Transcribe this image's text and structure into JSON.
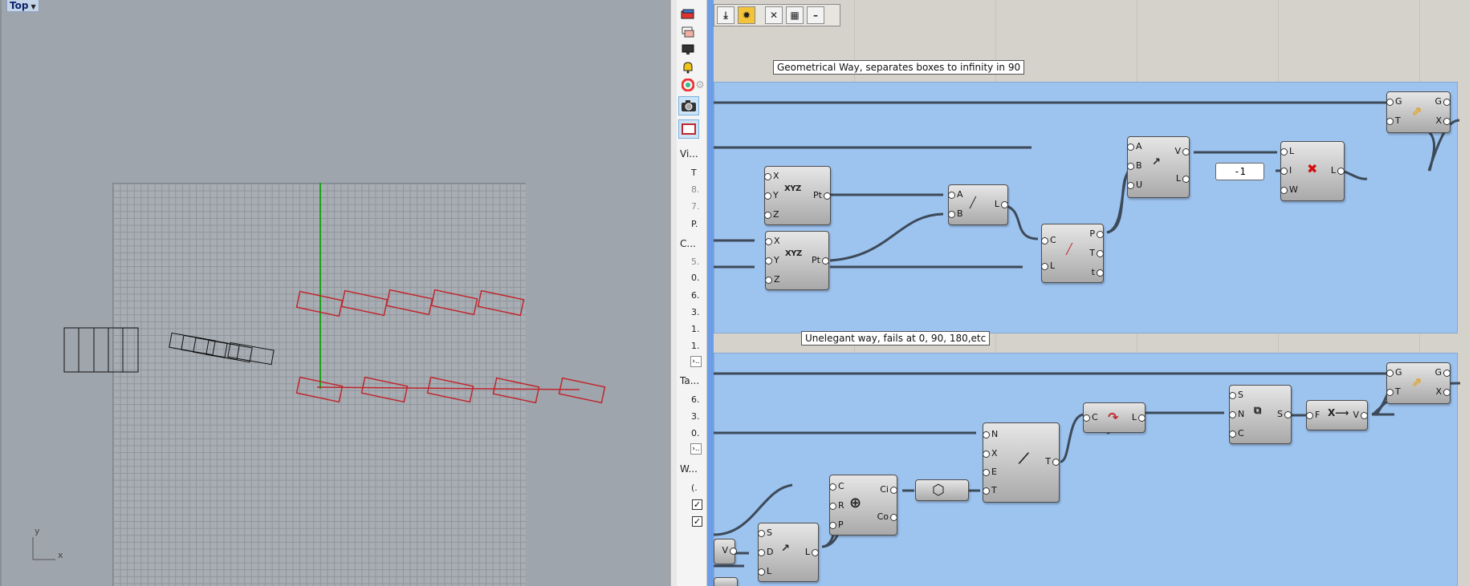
{
  "viewport": {
    "title": "Top",
    "axis_y": "y",
    "axis_x": "x"
  },
  "side_panel": {
    "icons": [
      "book-stack-icon",
      "layers-icon",
      "display-icon",
      "bell-icon",
      "color-wheel-icon",
      "gear-icon",
      "camera-icon",
      "frame-icon"
    ],
    "section1_label": "Vi...",
    "section1_rows": [
      "T",
      "8.",
      "7.",
      "P."
    ],
    "section2_label": "C...",
    "section2_rows": [
      "5.",
      "0.",
      "6.",
      "3.",
      "1.",
      "1."
    ],
    "section2_button": "›..",
    "section3_label": "Ta...",
    "section3_rows": [
      "6.",
      "3.",
      "0."
    ],
    "section3_button": "›..",
    "section4_label": "W...",
    "section4_row": "(.",
    "checkbox_mark": "✓"
  },
  "gh": {
    "toolbar": [
      "⤓",
      "✹",
      "✕",
      "▦",
      "–"
    ],
    "group1_label": "Geometrical Way, separates boxes to infinity in 90",
    "group2_label": "Unelegant way, fails at 0, 90, 180,etc",
    "panel_value": "-1",
    "ports": {
      "X": "X",
      "Y": "Y",
      "Z": "Z",
      "Pt": "Pt",
      "A": "A",
      "B": "B",
      "L": "L",
      "C": "C",
      "P": "P",
      "T": "T",
      "t": "t",
      "U": "U",
      "V": "V",
      "I": "I",
      "W": "W",
      "G": "G",
      "S": "S",
      "N": "N",
      "E": "E",
      "D": "D",
      "R": "R",
      "Ci": "Ci",
      "Co": "Co",
      "F": "F"
    },
    "icon_glyphs": {
      "xyz": "XYZ",
      "line": "╱",
      "vector": "↗",
      "cull": "✖",
      "transform": "⇗",
      "curve": "↷",
      "graft": "⧉",
      "deconstruct": "X⟶",
      "circle": "⊕",
      "hex": "⬡",
      "brush": "⟋"
    }
  }
}
